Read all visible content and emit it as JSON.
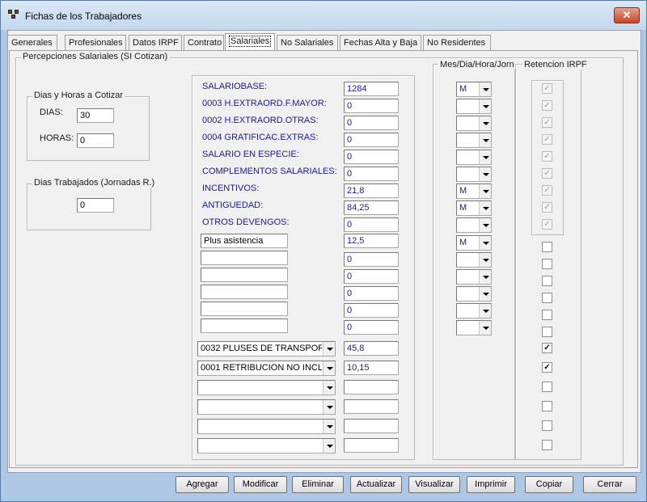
{
  "window": {
    "title": "Fichas de los Trabajadores",
    "close_glyph": "✕"
  },
  "tabs": [
    "Generales",
    "Profesionales",
    "Datos IRPF",
    "Contrato",
    "Salariales",
    "No Salariales",
    "Fechas Alta y Baja",
    "No Residentes"
  ],
  "active_tab": "Salariales",
  "percepciones": {
    "group_title": "Percepciones Salariales (SI Cotizan)",
    "dias_horas": {
      "title": "Dias y Horas a Cotizar",
      "dias_label": "DIAS:",
      "dias_value": "30",
      "horas_label": "HORAS:",
      "horas_value": "0"
    },
    "dias_trabajados": {
      "title": "Dias Trabajados (Jornadas R.)",
      "value": "0"
    }
  },
  "fixed_rows": [
    {
      "label": "SALARIOBASE:",
      "value": "1284",
      "period": "M",
      "irpf": true
    },
    {
      "label": "0003 H.EXTRAORD.F.MAYOR:",
      "value": "0",
      "period": "",
      "irpf": true
    },
    {
      "label": "0002 H.EXTRAORD.OTRAS:",
      "value": "0",
      "period": "",
      "irpf": true
    },
    {
      "label": "0004 GRATIFICAC.EXTRAS:",
      "value": "0",
      "period": "",
      "irpf": true
    },
    {
      "label": "SALARIO EN ESPECIE:",
      "value": "0",
      "period": "",
      "irpf": true
    },
    {
      "label": "COMPLEMENTOS SALARIALES:",
      "value": "0",
      "period": "",
      "irpf": true
    },
    {
      "label": " INCENTIVOS:",
      "value": "21,8",
      "period": "M",
      "irpf": true
    },
    {
      "label": "ANTIGUEDAD:",
      "value": "84,25",
      "period": "M",
      "irpf": true
    },
    {
      "label": "OTROS DEVENGOS:",
      "value": "0",
      "period": "",
      "irpf": true
    }
  ],
  "free_rows": [
    {
      "label": "Plus asistencia",
      "value": "12,5",
      "period": "M",
      "irpf": false
    },
    {
      "label": "",
      "value": "0",
      "period": "",
      "irpf": false
    },
    {
      "label": "",
      "value": "0",
      "period": "",
      "irpf": false
    },
    {
      "label": "",
      "value": "0",
      "period": "",
      "irpf": false
    },
    {
      "label": "",
      "value": "0",
      "period": "",
      "irpf": false
    },
    {
      "label": "",
      "value": "0",
      "period": "",
      "irpf": false
    }
  ],
  "combo_rows": [
    {
      "label": "0032 PLUSES DE TRANSPOR",
      "value": "45,8",
      "irpf": true
    },
    {
      "label": "0001 RETRIBUCION NO INCLU",
      "value": "10,15",
      "irpf": true
    },
    {
      "label": "",
      "value": "",
      "irpf": false
    },
    {
      "label": "",
      "value": "",
      "irpf": false
    },
    {
      "label": "",
      "value": "",
      "irpf": false
    },
    {
      "label": "",
      "value": "",
      "irpf": false
    }
  ],
  "columns": {
    "period_header": "Mes/Dia/Hora/Jorn",
    "irpf_header": "Retencion IRPF"
  },
  "buttons": [
    "Agregar",
    "Modificar",
    "Eliminar",
    "Actualizar",
    "Visualizar",
    "Imprimir",
    "Copiar",
    "Cerrar"
  ]
}
